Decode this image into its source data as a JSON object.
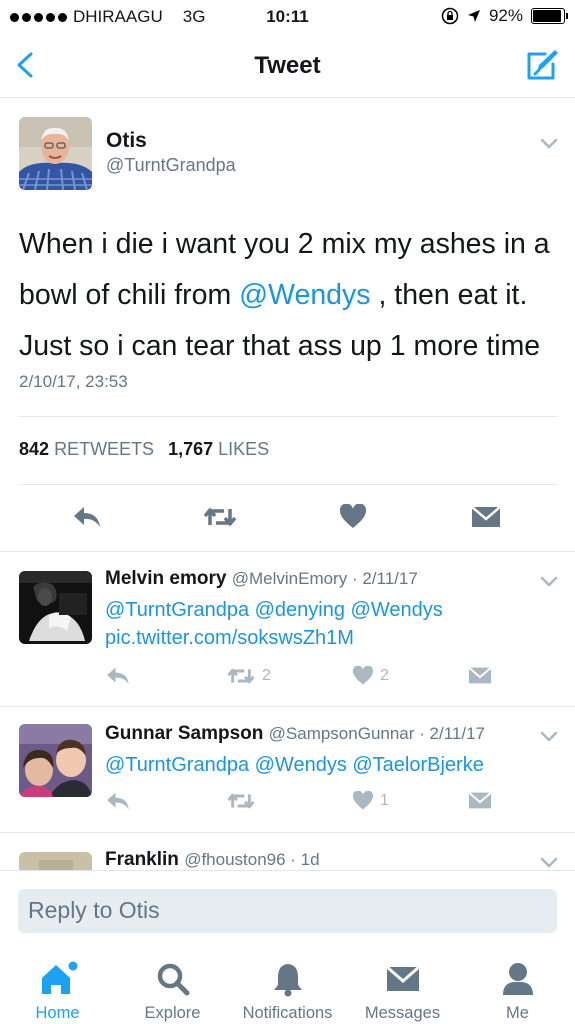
{
  "status_bar": {
    "carrier": "DHIRAAGU",
    "network": "3G",
    "time": "10:11",
    "battery": "92%",
    "battery_level": 0.92
  },
  "nav": {
    "title": "Tweet"
  },
  "tweet": {
    "name": "Otis",
    "handle": "@TurntGrandpa",
    "text_1": "When i die i want you 2 mix my ashes in a bowl of chili from ",
    "mention": "@Wendys",
    "text_2": " , then eat it. Just so i can tear that ass up 1 more time",
    "timestamp": "2/10/17, 23:53",
    "retweets": "842",
    "retweets_label": "RETWEETS",
    "likes": "1,767",
    "likes_label": "LIKES"
  },
  "replies": [
    {
      "name": "Melvin emory",
      "meta": "@MelvinEmory · 2/11/17",
      "body": "@TurntGrandpa @denying @Wendys pic.twitter.com/sokswsZh1M",
      "retweets": "2",
      "likes": "2"
    },
    {
      "name": "Gunnar Sampson",
      "meta": "@SampsonGunnar · 2/11/17",
      "body": "@TurntGrandpa @Wendys @TaelorBjerke",
      "retweets": "",
      "likes": "1"
    },
    {
      "name": "Franklin",
      "meta": "@fhouston96 · 1d"
    }
  ],
  "reply_bar": {
    "placeholder": "Reply to Otis"
  },
  "tabs": [
    {
      "label": "Home",
      "icon": "home-icon"
    },
    {
      "label": "Explore",
      "icon": "search-icon"
    },
    {
      "label": "Notifications",
      "icon": "bell-icon"
    },
    {
      "label": "Messages",
      "icon": "envelope-icon"
    },
    {
      "label": "Me",
      "icon": "person-icon"
    }
  ],
  "colors": {
    "accent": "#1da1f2",
    "link": "#1b95e0",
    "muted": "#657786",
    "icon_gray": "#aab8c2"
  }
}
